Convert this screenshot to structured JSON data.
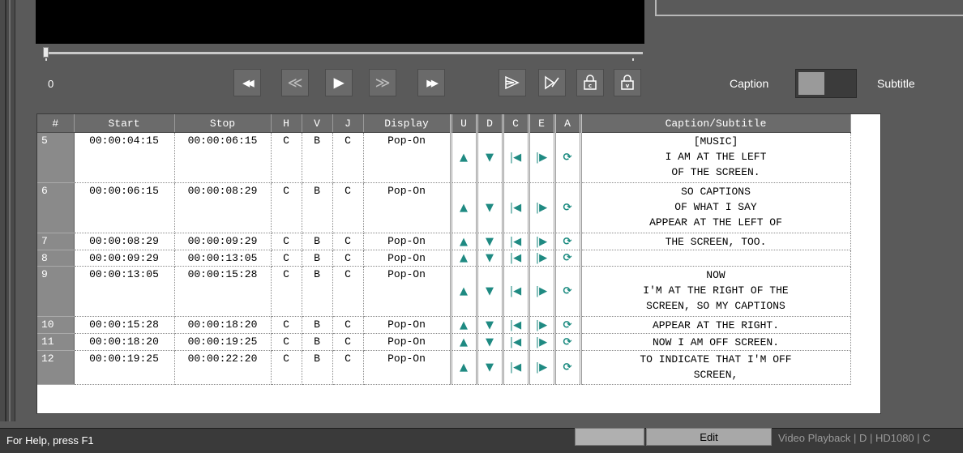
{
  "player": {
    "time_label": "0"
  },
  "transport": {
    "rewind": "◀◀",
    "step_back": "≪",
    "play": "▶",
    "step_forward": "≫",
    "fast_forward": "▶▶"
  },
  "toggle": {
    "left_label": "Caption",
    "right_label": "Subtitle",
    "state": "Caption"
  },
  "table": {
    "columns": [
      "#",
      "Start",
      "Stop",
      "H",
      "V",
      "J",
      "Display",
      "U",
      "D",
      "C",
      "E",
      "A",
      "Caption/Subtitle"
    ],
    "rows": [
      {
        "num": "5",
        "start": "00:00:04:15",
        "stop": "00:00:06:15",
        "h": "C",
        "v": "B",
        "j": "C",
        "display": "Pop-On",
        "caption": [
          "[MUSIC]",
          "I AM AT THE LEFT",
          "OF THE SCREEN."
        ]
      },
      {
        "num": "6",
        "start": "00:00:06:15",
        "stop": "00:00:08:29",
        "h": "C",
        "v": "B",
        "j": "C",
        "display": "Pop-On",
        "caption": [
          "SO CAPTIONS",
          "OF WHAT I SAY",
          "APPEAR AT THE LEFT OF"
        ]
      },
      {
        "num": "7",
        "start": "00:00:08:29",
        "stop": "00:00:09:29",
        "h": "C",
        "v": "B",
        "j": "C",
        "display": "Pop-On",
        "caption": [
          "THE SCREEN, TOO."
        ]
      },
      {
        "num": "8",
        "start": "00:00:09:29",
        "stop": "00:00:13:05",
        "h": "C",
        "v": "B",
        "j": "C",
        "display": "Pop-On",
        "caption": [
          ""
        ]
      },
      {
        "num": "9",
        "start": "00:00:13:05",
        "stop": "00:00:15:28",
        "h": "C",
        "v": "B",
        "j": "C",
        "display": "Pop-On",
        "caption": [
          "NOW",
          "I'M AT THE RIGHT OF THE",
          "SCREEN, SO MY CAPTIONS"
        ]
      },
      {
        "num": "10",
        "start": "00:00:15:28",
        "stop": "00:00:18:20",
        "h": "C",
        "v": "B",
        "j": "C",
        "display": "Pop-On",
        "caption": [
          "APPEAR AT THE RIGHT."
        ]
      },
      {
        "num": "11",
        "start": "00:00:18:20",
        "stop": "00:00:19:25",
        "h": "C",
        "v": "B",
        "j": "C",
        "display": "Pop-On",
        "caption": [
          "NOW I AM OFF SCREEN."
        ]
      },
      {
        "num": "12",
        "start": "00:00:19:25",
        "stop": "00:00:22:20",
        "h": "C",
        "v": "B",
        "j": "C",
        "display": "Pop-On",
        "caption": [
          "TO INDICATE THAT I'M OFF",
          "SCREEN,"
        ]
      }
    ],
    "icons": {
      "up": "▲",
      "down": "▼",
      "c": "|◀",
      "e": "|▶",
      "a": "⟳"
    }
  },
  "status": {
    "help_text": "For Help, press F1",
    "mode": "Edit",
    "right_text": "Video Playback | D | HD1080 | C"
  },
  "colors": {
    "accent_teal": "#1a8a7f",
    "background": "#5a5a5a",
    "header_bg": "#6b6b6b"
  }
}
